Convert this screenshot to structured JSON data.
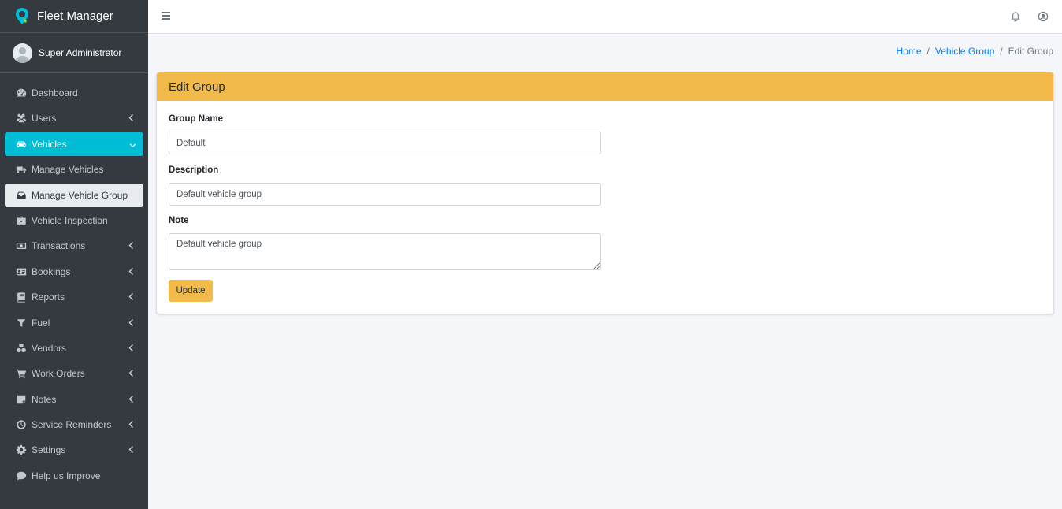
{
  "app": {
    "title": "Fleet Manager",
    "brand_color": "#00bcd4"
  },
  "user": {
    "name": "Super Administrator"
  },
  "sidebar": {
    "items": [
      {
        "label": "Dashboard",
        "icon": "dashboard-icon",
        "has_chevron": false
      },
      {
        "label": "Users",
        "icon": "users-icon",
        "has_chevron": true
      },
      {
        "label": "Vehicles",
        "icon": "car-icon",
        "has_chevron": true,
        "active": true
      },
      {
        "label": "Manage Vehicles",
        "icon": "truck-icon",
        "has_chevron": false
      },
      {
        "label": "Manage Vehicle Group",
        "icon": "inbox-icon",
        "has_chevron": false,
        "selected": true
      },
      {
        "label": "Vehicle Inspection",
        "icon": "briefcase-icon",
        "has_chevron": false
      },
      {
        "label": "Transactions",
        "icon": "money-icon",
        "has_chevron": true
      },
      {
        "label": "Bookings",
        "icon": "address-card-icon",
        "has_chevron": true
      },
      {
        "label": "Reports",
        "icon": "book-icon",
        "has_chevron": true
      },
      {
        "label": "Fuel",
        "icon": "filter-icon",
        "has_chevron": true
      },
      {
        "label": "Vendors",
        "icon": "cubes-icon",
        "has_chevron": true
      },
      {
        "label": "Work Orders",
        "icon": "cart-icon",
        "has_chevron": true
      },
      {
        "label": "Notes",
        "icon": "sticky-note-icon",
        "has_chevron": true
      },
      {
        "label": "Service Reminders",
        "icon": "clock-icon",
        "has_chevron": true
      },
      {
        "label": "Settings",
        "icon": "gear-icon",
        "has_chevron": true
      },
      {
        "label": "Help us Improve",
        "icon": "comment-icon",
        "has_chevron": false
      }
    ]
  },
  "breadcrumb": {
    "home": "Home",
    "parent": "Vehicle Group",
    "current": "Edit Group",
    "separator": "/"
  },
  "card": {
    "title": "Edit Group",
    "header_color": "#f2ba4a",
    "fields": {
      "group_name": {
        "label": "Group Name",
        "value": "Default"
      },
      "description": {
        "label": "Description",
        "value": "Default vehicle group"
      },
      "note": {
        "label": "Note",
        "value": "Default vehicle group"
      }
    },
    "submit_label": "Update"
  }
}
